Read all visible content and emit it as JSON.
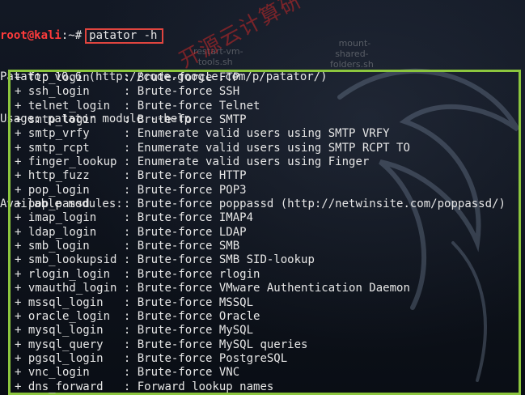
{
  "terminal": {
    "prompt_user": "root@kali",
    "prompt_path": ":~#",
    "command": "patator -h",
    "version_line": "Patator v0.6 (http://code.google.com/p/patator/)",
    "usage_line": "Usage: patator module --help",
    "available_label": "Available modules:",
    "modules": [
      {
        "name": "ftp_login",
        "desc": "Brute-force FTP"
      },
      {
        "name": "ssh_login",
        "desc": "Brute-force SSH"
      },
      {
        "name": "telnet_login",
        "desc": "Brute-force Telnet"
      },
      {
        "name": "smtp_login",
        "desc": "Brute-force SMTP"
      },
      {
        "name": "smtp_vrfy",
        "desc": "Enumerate valid users using SMTP VRFY"
      },
      {
        "name": "smtp_rcpt",
        "desc": "Enumerate valid users using SMTP RCPT TO"
      },
      {
        "name": "finger_lookup",
        "desc": "Enumerate valid users using Finger"
      },
      {
        "name": "http_fuzz",
        "desc": "Brute-force HTTP"
      },
      {
        "name": "pop_login",
        "desc": "Brute-force POP3"
      },
      {
        "name": "pop_passd",
        "desc": "Brute-force poppassd (http://netwinsite.com/poppassd/)"
      },
      {
        "name": "imap_login",
        "desc": "Brute-force IMAP4"
      },
      {
        "name": "ldap_login",
        "desc": "Brute-force LDAP"
      },
      {
        "name": "smb_login",
        "desc": "Brute-force SMB"
      },
      {
        "name": "smb_lookupsid",
        "desc": "Brute-force SMB SID-lookup"
      },
      {
        "name": "rlogin_login",
        "desc": "Brute-force rlogin"
      },
      {
        "name": "vmauthd_login",
        "desc": "Brute-force VMware Authentication Daemon"
      },
      {
        "name": "mssql_login",
        "desc": "Brute-force MSSQL"
      },
      {
        "name": "oracle_login",
        "desc": "Brute-force Oracle"
      },
      {
        "name": "mysql_login",
        "desc": "Brute-force MySQL"
      },
      {
        "name": "mysql_query",
        "desc": "Brute-force MySQL queries"
      },
      {
        "name": "pgsql_login",
        "desc": "Brute-force PostgreSQL"
      },
      {
        "name": "vnc_login",
        "desc": "Brute-force VNC"
      },
      {
        "name": "dns_forward",
        "desc": "Forward lookup names"
      }
    ]
  },
  "desktop": {
    "icon_left_label": "restart-vm-\ntools.sh",
    "icon_right_label": "mount-\nshared-\nfolders.sh"
  },
  "watermark": {
    "text": "开源云计算研",
    "color": "#c82828"
  },
  "colors": {
    "prompt_user": "#ff3b3b",
    "command_box": "#e0453f",
    "modules_box": "#8cc63e",
    "text": "#e6e6e6",
    "background": "#0b1018"
  }
}
